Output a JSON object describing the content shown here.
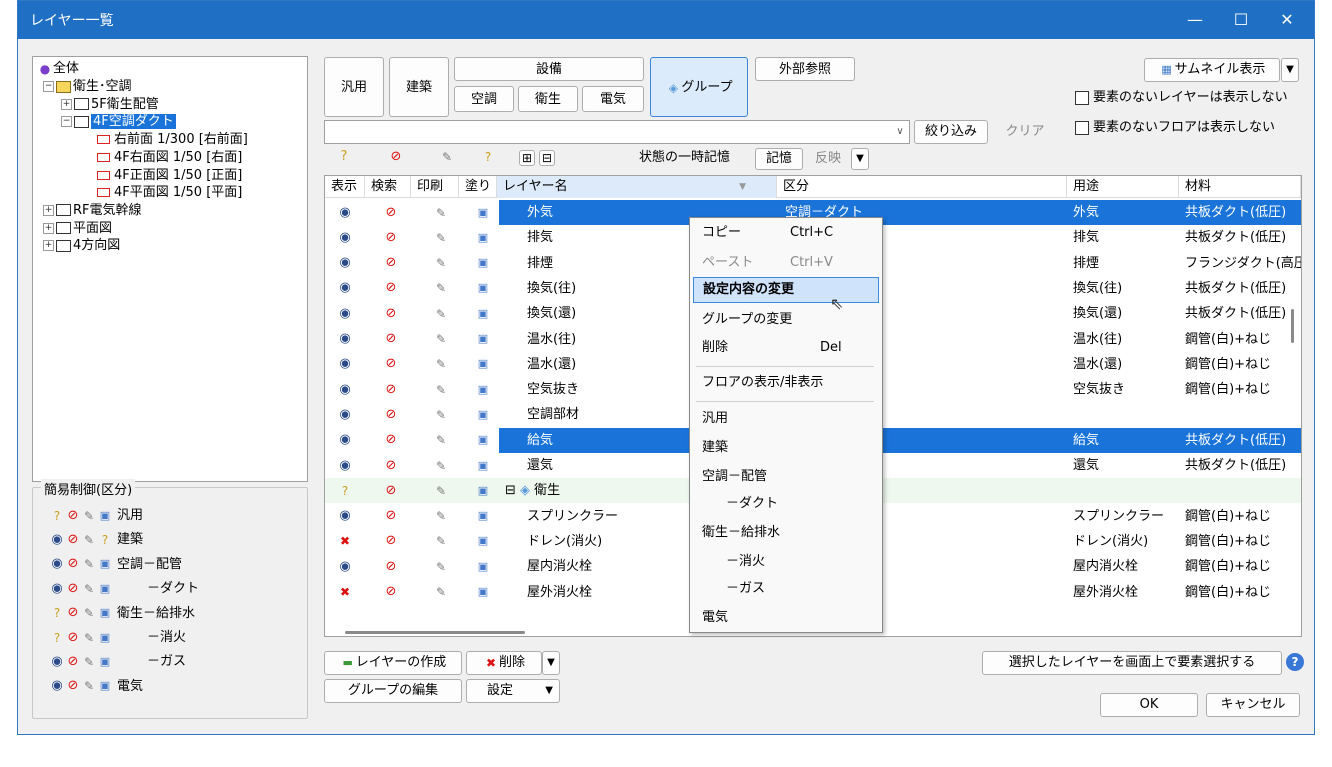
{
  "window": {
    "title": "レイヤー一覧",
    "min": "—",
    "max": "☐",
    "close": "✕"
  },
  "tree": {
    "root": "全体",
    "nodes": [
      {
        "label": "衛生･空調",
        "level": 1,
        "expander": "−",
        "folder": "yellow"
      },
      {
        "label": "5F衛生配管",
        "level": 2,
        "expander": "+",
        "folder": "white"
      },
      {
        "label": "4F空調ダクト",
        "level": 2,
        "expander": "−",
        "folder": "white",
        "selected": true
      },
      {
        "label": "右前面 1/300 [右前面]",
        "level": 3,
        "expander": "",
        "folder": "red"
      },
      {
        "label": "4F右面図 1/50 [右面]",
        "level": 3,
        "expander": "",
        "folder": "red"
      },
      {
        "label": "4F正面図 1/50 [正面]",
        "level": 3,
        "expander": "",
        "folder": "red"
      },
      {
        "label": "4F平面図 1/50 [平面]",
        "level": 3,
        "expander": "",
        "folder": "red"
      },
      {
        "label": "RF電気幹線",
        "level": 1,
        "expander": "+",
        "folder": "white"
      },
      {
        "label": "平面図",
        "level": 1,
        "expander": "+",
        "folder": "white"
      },
      {
        "label": "4方向図",
        "level": 1,
        "expander": "+",
        "folder": "white"
      }
    ]
  },
  "simple_control": {
    "title": "簡易制御(区分)",
    "items": [
      {
        "label": "汎用",
        "eye": "?",
        "fill": "plain"
      },
      {
        "label": "建築",
        "eye": "eye",
        "fill": "?"
      },
      {
        "label": "空調－配管",
        "eye": "eye",
        "fill": "plain"
      },
      {
        "label": "－ダクト",
        "eye": "eye",
        "fill": "plain"
      },
      {
        "label": "衛生－給排水",
        "eye": "?",
        "fill": "plain"
      },
      {
        "label": "－消火",
        "eye": "?",
        "fill": "plain"
      },
      {
        "label": "－ガス",
        "eye": "eye",
        "fill": "plain"
      },
      {
        "label": "電気",
        "eye": "eye",
        "fill": "plain"
      }
    ]
  },
  "category_buttons": {
    "general": "汎用",
    "architecture": "建築",
    "equipment": "設備",
    "hvac": "空調",
    "sanitary": "衛生",
    "electric": "電気",
    "group": "グループ",
    "external_ref": "外部参照"
  },
  "thumbnail": {
    "label": "サムネイル表示",
    "arrow": "▼"
  },
  "options": {
    "hide_empty_layers": "要素のないレイヤーは表示しない",
    "hide_empty_floors": "要素のないフロアは表示しない"
  },
  "filter": {
    "value": "",
    "narrow_label": "絞り込み",
    "clear_label": "クリア"
  },
  "state_memory": {
    "label": "状態の一時記憶",
    "memorize": "記憶",
    "reflect": "反映"
  },
  "table": {
    "headers": {
      "show": "表示",
      "search": "検索",
      "print": "印刷",
      "fill": "塗り",
      "name": "レイヤー名",
      "class": "区分",
      "use": "用途",
      "material": "材料"
    },
    "rows": [
      {
        "name": "外気",
        "class": "空調－ダクト",
        "use": "外気",
        "material": "共板ダクト(低圧)",
        "sel": true,
        "eye": "eye"
      },
      {
        "name": "排気",
        "class": "",
        "use": "排気",
        "material": "共板ダクト(低圧)",
        "eye": "eye"
      },
      {
        "name": "排煙",
        "class": "",
        "use": "排煙",
        "material": "フランジダクト(高圧)",
        "eye": "eye"
      },
      {
        "name": "換気(往)",
        "class": "",
        "use": "換気(往)",
        "material": "共板ダクト(低圧)",
        "eye": "eye"
      },
      {
        "name": "換気(還)",
        "class": "",
        "use": "換気(還)",
        "material": "共板ダクト(低圧)",
        "eye": "eye"
      },
      {
        "name": "温水(往)",
        "class": "",
        "use": "温水(往)",
        "material": "鋼管(白)+ねじ",
        "eye": "eye"
      },
      {
        "name": "温水(還)",
        "class": "",
        "use": "温水(還)",
        "material": "鋼管(白)+ねじ",
        "eye": "eye"
      },
      {
        "name": "空気抜き",
        "class": "",
        "use": "空気抜き",
        "material": "鋼管(白)+ねじ",
        "eye": "eye"
      },
      {
        "name": "空調部材",
        "class": "",
        "use": "",
        "material": "",
        "eye": "eye"
      },
      {
        "name": "給気",
        "class": "",
        "use": "給気",
        "material": "共板ダクト(低圧)",
        "sel": true,
        "eye": "eye"
      },
      {
        "name": "還気",
        "class": "",
        "use": "還気",
        "material": "共板ダクト(低圧)",
        "eye": "eye"
      },
      {
        "name": "衛生",
        "class": "",
        "use": "",
        "material": "",
        "group": true,
        "eye": "?"
      },
      {
        "name": "スプリンクラー",
        "class": "",
        "use": "スプリンクラー",
        "material": "鋼管(白)+ねじ",
        "eye": "eye"
      },
      {
        "name": "ドレン(消火)",
        "class": "",
        "use": "ドレン(消火)",
        "material": "鋼管(白)+ねじ",
        "eye": "x"
      },
      {
        "name": "屋内消火栓",
        "class": "",
        "use": "屋内消火栓",
        "material": "鋼管(白)+ねじ",
        "eye": "eye"
      },
      {
        "name": "屋外消火栓",
        "class": "",
        "use": "屋外消火栓",
        "material": "鋼管(白)+ねじ",
        "eye": "x"
      }
    ]
  },
  "context_menu": {
    "copy": "コピー",
    "copy_sc": "Ctrl+C",
    "paste": "ペースト",
    "paste_sc": "Ctrl+V",
    "change_settings": "設定内容の変更",
    "change_group": "グループの変更",
    "delete": "削除",
    "delete_sc": "Del",
    "floor_toggle": "フロアの表示/非表示",
    "general": "汎用",
    "architecture": "建築",
    "hvac_pipe": "空調－配管",
    "duct": "－ダクト",
    "sanitary_water": "衛生－給排水",
    "fire": "－消火",
    "gas": "－ガス",
    "electric": "電気"
  },
  "bottom": {
    "create_layer": "レイヤーの作成",
    "delete": "削除",
    "edit_group": "グループの編集",
    "settings": "設定",
    "select_on_screen": "選択したレイヤーを画面上で要素選択する",
    "ok": "OK",
    "cancel": "キャンセル"
  },
  "colors": {
    "accent": "#1f6fc5",
    "selection": "#1a73d8",
    "hover": "#cfe3fb"
  }
}
